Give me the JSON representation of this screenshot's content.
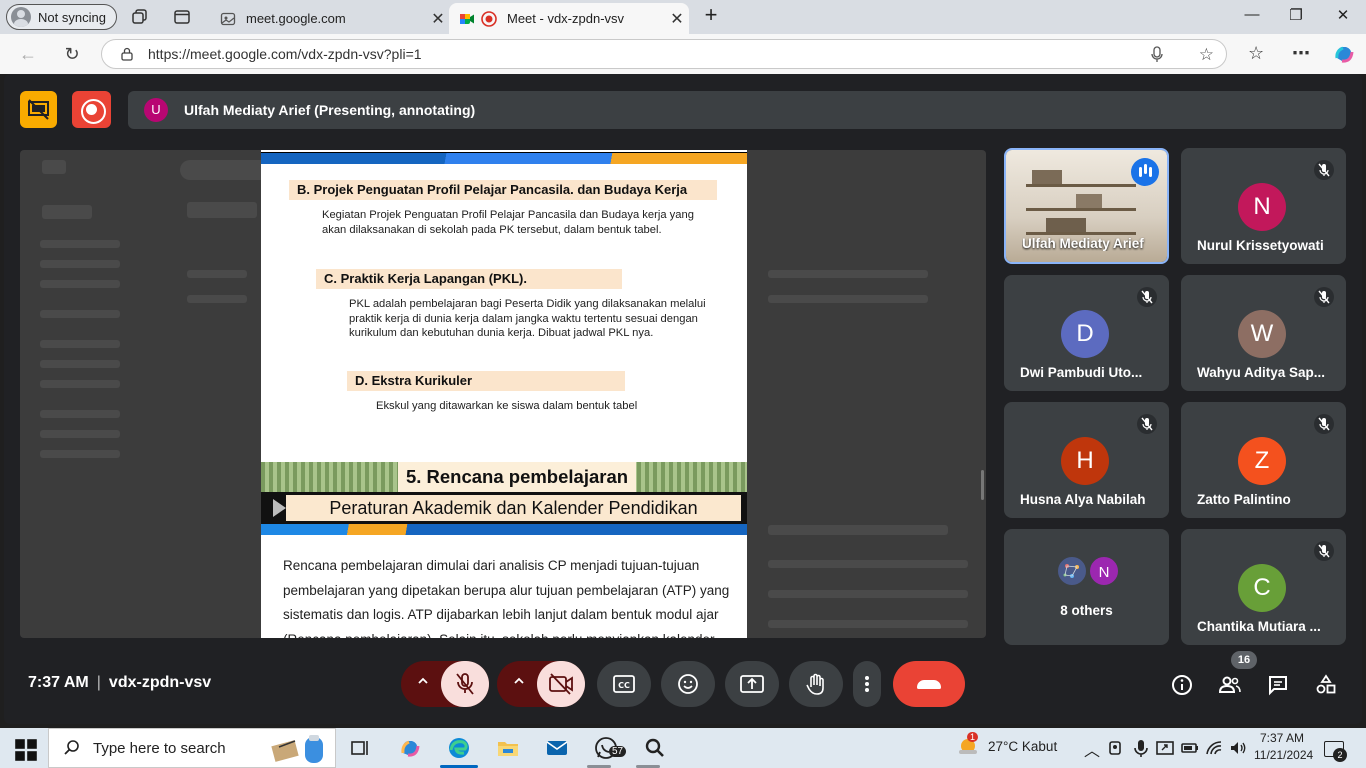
{
  "browser": {
    "profile_label": "Not syncing",
    "tabs": [
      {
        "label": "meet.google.com"
      },
      {
        "label": "Meet - vdx-zpdn-vsv"
      }
    ],
    "url": "https://meet.google.com/vdx-zpdn-vsv?pli=1"
  },
  "meet": {
    "presenter_initial": "U",
    "presenter_title": "Ulfah Mediaty Arief (Presenting, annotating)",
    "time": "7:37 AM",
    "meeting_code": "vdx-zpdn-vsv",
    "participant_count": "16"
  },
  "slide": {
    "sections": [
      {
        "head": "B.  Projek Penguatan Profil Pelajar Pancasila. dan Budaya Kerja",
        "body": "Kegiatan Projek Penguatan Profil Pelajar Pancasila dan Budaya kerja yang akan dilaksanakan di sekolah pada PK tersebut, dalam bentuk tabel."
      },
      {
        "head": "C.  Praktik Kerja Lapangan (PKL).",
        "body": "PKL adalah pembelajaran bagi Peserta Didik yang dilaksanakan melalui praktik kerja di dunia kerja dalam jangka waktu tertentu sesuai dengan kurikulum dan kebutuhan dunia kerja. Dibuat jadwal PKL nya."
      },
      {
        "head": "D.  Ekstra Kurikuler",
        "body": "Ekskul yang ditawarkan ke siswa dalam bentuk tabel"
      }
    ],
    "header_title": "5. Rencana pembelajaran",
    "sub_title": "Peraturan Akademik dan Kalender Pendidikan",
    "paragraph": "Rencana pembelajaran dimulai dari analisis CP menjadi tujuan-tujuan pembelajaran yang dipetakan berupa alur tujuan pembelajaran (ATP) yang sistematis dan logis. ATP dijabarkan lebih lanjut dalam bentuk modul ajar (Rencana pembelajaran). Selain itu, sekolah perlu menyiapkan kalender"
  },
  "participants": [
    {
      "name": "Ulfah Mediaty Arief",
      "initial": "",
      "color": "",
      "muted": false,
      "self": true
    },
    {
      "name": "Nurul Krissetyowati",
      "initial": "N",
      "color": "#c2185b",
      "muted": true
    },
    {
      "name": "Dwi Pambudi Uto...",
      "initial": "D",
      "color": "#5c6bc0",
      "muted": true
    },
    {
      "name": "Wahyu Aditya Sap...",
      "initial": "W",
      "color": "#8d6e63",
      "muted": true
    },
    {
      "name": "Husna Alya Nabilah",
      "initial": "H",
      "color": "#bf360c",
      "muted": true
    },
    {
      "name": "Zatto Palintino",
      "initial": "Z",
      "color": "#f4511e",
      "muted": true
    },
    {
      "name": "8 others",
      "initial": "N",
      "color": "#9c27b0",
      "muted": false
    },
    {
      "name": "Chantika Mutiara ...",
      "initial": "C",
      "color": "#689f38",
      "muted": true
    }
  ],
  "taskbar": {
    "search_placeholder": "Type here to search",
    "whatsapp_badge": "57",
    "weather": "27°C  Kabut",
    "weather_alert": "1",
    "time": "7:37 AM",
    "date": "11/21/2024",
    "notifications": "2"
  },
  "colors": {
    "meet_bg": "#202124",
    "tile_bg": "#3c4043",
    "end_call": "#ea4335",
    "accent": "#8ab4f8"
  }
}
